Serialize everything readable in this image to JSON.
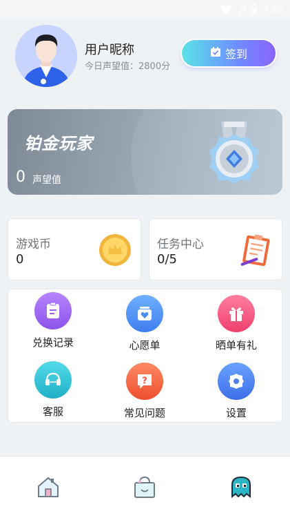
{
  "status_bar": {
    "time": "7:35",
    "icons": [
      "wifi-icon",
      "signal-icon",
      "battery-icon"
    ]
  },
  "profile": {
    "nickname": "用户昵称",
    "reputation_today": "今日声望值：2800分",
    "checkin_label": "签到",
    "avatar_icon": "user-avatar"
  },
  "rank_card": {
    "title": "铂金玩家",
    "points": "0",
    "points_label": "声望值",
    "medal_icon": "platinum-medal-icon"
  },
  "stats": [
    {
      "label": "游戏币",
      "value": "0",
      "icon": "coin-icon"
    },
    {
      "label": "任务中心",
      "value": "0/5",
      "icon": "clipboard-task-icon"
    }
  ],
  "menu": [
    {
      "label": "兑换记录",
      "icon": "exchange-record-icon",
      "color": "#a66cf2"
    },
    {
      "label": "心愿单",
      "icon": "wishlist-icon",
      "color": "#4a8ef2"
    },
    {
      "label": "晒单有礼",
      "icon": "gift-icon",
      "color": "#f2547c"
    },
    {
      "label": "客服",
      "icon": "customer-service-icon",
      "color": "#2cc5d8"
    },
    {
      "label": "常见问题",
      "icon": "faq-icon",
      "color": "#f2623d"
    },
    {
      "label": "设置",
      "icon": "settings-icon",
      "color": "#4a7ff2"
    }
  ],
  "bottom_nav": [
    {
      "name": "home",
      "icon": "home-icon"
    },
    {
      "name": "shop",
      "icon": "shopping-bag-icon"
    },
    {
      "name": "profile",
      "icon": "ghost-icon"
    }
  ]
}
